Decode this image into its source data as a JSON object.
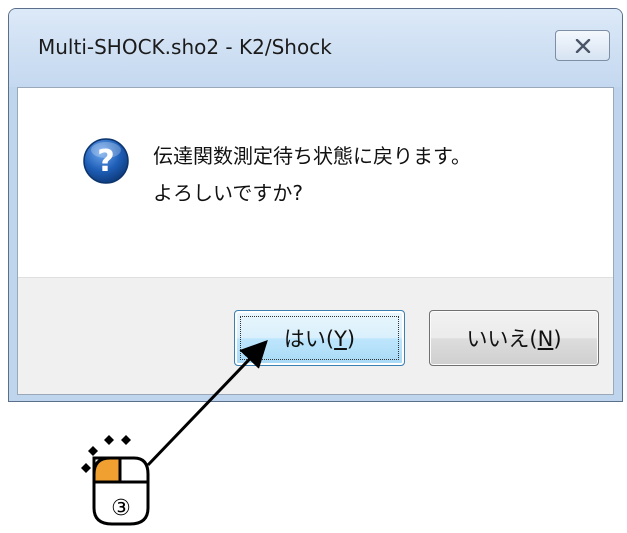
{
  "window": {
    "title": "Multi-SHOCK.sho2 - K2/Shock"
  },
  "dialog": {
    "message_line1": "伝達関数測定待ち状態に戻ります。",
    "message_line2": "よろしいですか?",
    "icon": "question-icon"
  },
  "buttons": {
    "yes_label_main": "はい(",
    "yes_label_key": "Y",
    "yes_label_end": ")",
    "no_label_main": "いいえ(",
    "no_label_key": "N",
    "no_label_end": ")"
  },
  "annotation": {
    "step_number": "③",
    "icon": "mouse-left-click-icon"
  },
  "colors": {
    "question_blue": "#1f5fb8",
    "mouse_button_highlight": "#f0a030"
  }
}
